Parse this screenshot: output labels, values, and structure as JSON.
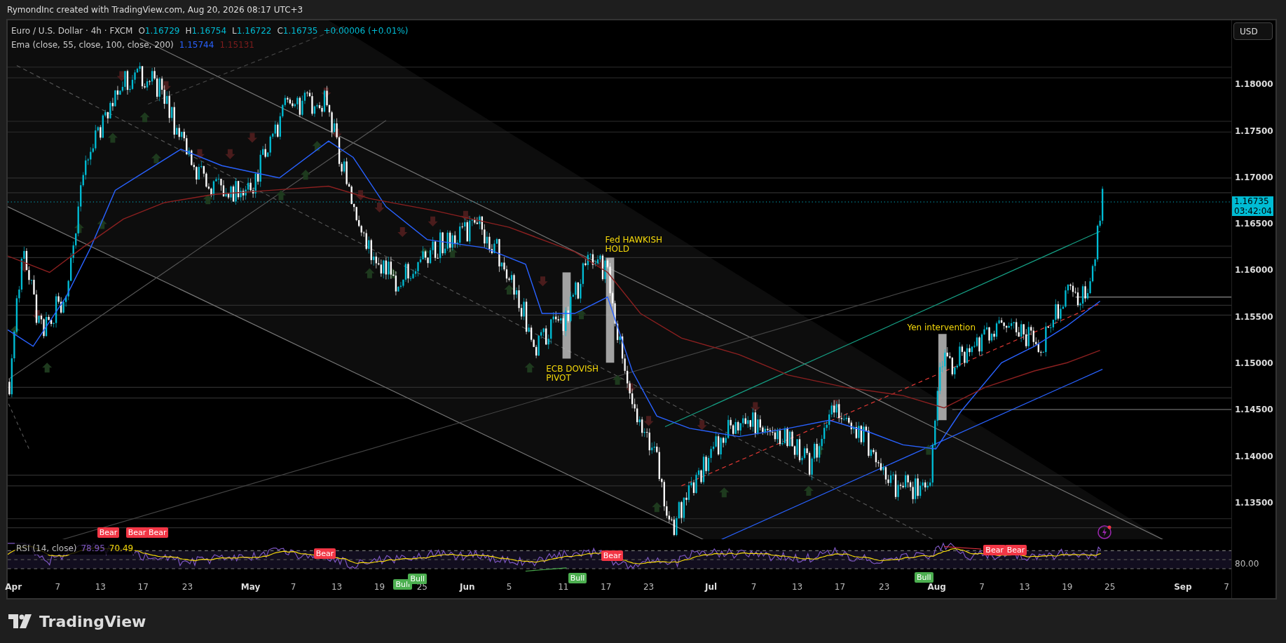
{
  "header": {
    "text": "RymondInc created with TradingView.com, Aug 20, 2026 08:17 UTC+3"
  },
  "legend": {
    "symbol": "Euro / U.S. Dollar · 4h · FXCM",
    "ohlc": [
      {
        "key": "O",
        "value": "1.16729"
      },
      {
        "key": "H",
        "value": "1.16754"
      },
      {
        "key": "L",
        "value": "1.16722"
      },
      {
        "key": "C",
        "value": "1.16735"
      }
    ],
    "change": "+0.00006 (+0.01%)"
  },
  "ema": {
    "label": "Ema (close, 55, close, 100, close, 200)",
    "values": [
      {
        "value": "1.15744",
        "color": "#2962ff"
      },
      {
        "value": "1.15131",
        "color": "#7f1d1d"
      }
    ]
  },
  "currency_button": "USD",
  "price_axis": {
    "labels": [
      "1.18000",
      "1.17500",
      "1.17000",
      "1.16500",
      "1.16000",
      "1.15500",
      "1.15000",
      "1.14500",
      "1.14000",
      "1.13500"
    ]
  },
  "last_price": {
    "price": "1.16735",
    "countdown": "03:42:04"
  },
  "annotations": [
    {
      "lines": [
        "Fed HAWKISH",
        "HOLD"
      ]
    },
    {
      "lines": [
        "ECB DOVISH",
        "PIVOT"
      ]
    },
    {
      "lines": [
        "Yen intervention"
      ]
    }
  ],
  "rsi": {
    "label": "RSI (14, close)",
    "values": [
      {
        "value": "78.95",
        "color": "#7e57c2"
      },
      {
        "value": "70.49",
        "color": "#f5d90a"
      }
    ],
    "axis_label": "80.00",
    "signals": [
      {
        "kind": "bear",
        "text": "Bear"
      },
      {
        "kind": "bear",
        "text": "Bear"
      },
      {
        "kind": "bear",
        "text": "Bear"
      },
      {
        "kind": "bear",
        "text": "Bear"
      },
      {
        "kind": "bear",
        "text": "Bear"
      },
      {
        "kind": "bear",
        "text": "Bear"
      },
      {
        "kind": "bear",
        "text": "Bear"
      },
      {
        "kind": "bull",
        "text": "Bull"
      },
      {
        "kind": "bull",
        "text": "Bull"
      },
      {
        "kind": "bull",
        "text": "Bull"
      },
      {
        "kind": "bull",
        "text": "Bull"
      }
    ]
  },
  "time_axis": {
    "labels": [
      "Apr",
      "7",
      "13",
      "17",
      "23",
      "May",
      "7",
      "13",
      "19",
      "25",
      "Jun",
      "5",
      "11",
      "17",
      "23",
      "Jul",
      "7",
      "13",
      "17",
      "23",
      "Aug",
      "7",
      "13",
      "19",
      "25",
      "Sep",
      "7"
    ]
  },
  "footer": {
    "brand": "TradingView"
  }
}
